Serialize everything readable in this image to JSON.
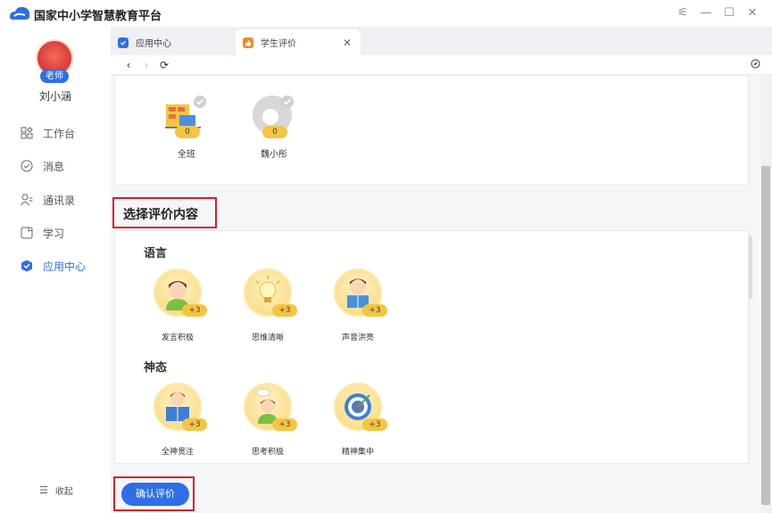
{
  "app": {
    "title": "国家中小学智慧教育平台"
  },
  "user": {
    "name": "刘小涵",
    "role_badge": "老师"
  },
  "sidebar": {
    "items": [
      {
        "label": "工作台",
        "icon": "grid-icon"
      },
      {
        "label": "消息",
        "icon": "message-icon"
      },
      {
        "label": "通讯录",
        "icon": "contacts-icon"
      },
      {
        "label": "学习",
        "icon": "study-icon"
      },
      {
        "label": "应用中心",
        "icon": "app-center-icon",
        "active": true
      }
    ],
    "collapse_label": "收起"
  },
  "tabs": [
    {
      "label": "应用中心",
      "active": false
    },
    {
      "label": "学生评价",
      "active": true
    }
  ],
  "students": [
    {
      "name": "全班",
      "score": "0"
    },
    {
      "name": "魏小彤",
      "score": "0"
    }
  ],
  "evaluation": {
    "title": "选择评价内容",
    "groups": [
      {
        "name": "语言",
        "items": [
          {
            "label": "发言积极",
            "points": "+3"
          },
          {
            "label": "思维清晰",
            "points": "+3"
          },
          {
            "label": "声音洪亮",
            "points": "+3"
          }
        ]
      },
      {
        "name": "神态",
        "items": [
          {
            "label": "全神贯注",
            "points": "+3"
          },
          {
            "label": "思考积极",
            "points": "+3"
          },
          {
            "label": "精神集中",
            "points": "+3"
          }
        ]
      }
    ]
  },
  "confirm_label": "确认评价",
  "colors": {
    "accent": "#2f6ee6",
    "highlight": "#d81f26",
    "badge": "#f5c542"
  }
}
